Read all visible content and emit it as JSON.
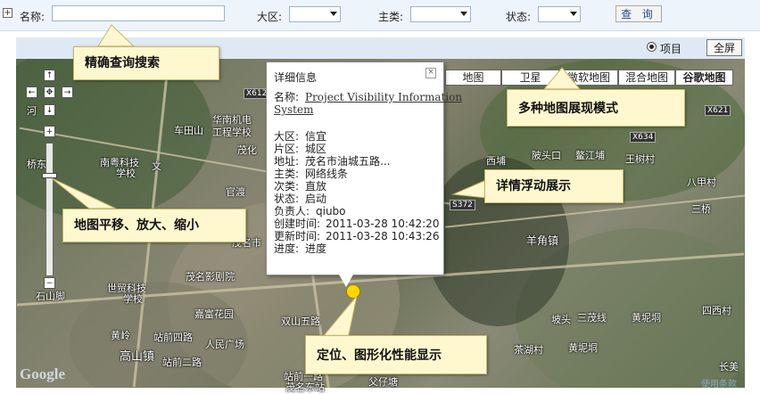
{
  "query": {
    "expand_icon": "+",
    "name_label": "名称:",
    "name_value": "",
    "region_label": "大区:",
    "region_value": "",
    "category_label": "主类:",
    "category_value": "",
    "status_label": "状态:",
    "status_value": "",
    "query_button": "查 询"
  },
  "map_header": {
    "radio_label": "项目",
    "fullscreen_button": "全屏"
  },
  "map_types": [
    "地图",
    "卫星",
    "微软地图",
    "混合地图",
    "谷歌地图"
  ],
  "nav": {
    "up": "↑",
    "left": "←",
    "center": "✥",
    "right": "→",
    "down": "↓",
    "zoom_in": "+",
    "zoom_out": "−"
  },
  "popup": {
    "title": "详细信息",
    "close": "×",
    "name_label": "名称:",
    "name_value_line1": "Project Visibility Information",
    "name_value_line2": "System",
    "rows": [
      {
        "label": "大区:",
        "value": "信宜"
      },
      {
        "label": "片区:",
        "value": "城区"
      },
      {
        "label": "地址:",
        "value": "茂名市油城五路..."
      },
      {
        "label": "主类:",
        "value": "网络线条"
      },
      {
        "label": "次类:",
        "value": "直放"
      },
      {
        "label": "状态:",
        "value": "启动"
      },
      {
        "label": "负责人:",
        "value": "qiubo"
      },
      {
        "label": "创建时间:",
        "value": "2011-03-28 10:42:20"
      },
      {
        "label": "更新时间:",
        "value": "2011-03-28 10:43:26"
      },
      {
        "label": "进度:",
        "value": "进度"
      }
    ]
  },
  "callouts": {
    "search": "精确查询搜索",
    "map_modes": "多种地图展现模式",
    "details": "详情浮动展示",
    "pan_zoom": "地图平移、放大、缩小",
    "locate": "定位、图形化性能显示"
  },
  "map_labels": [
    "河",
    "华南机电",
    "工程学校",
    "车田山",
    "X612",
    "茂化",
    "桥东",
    "南粤科技",
    "学校",
    "文",
    "官渡",
    "茂名市",
    "茂名影剧院",
    "世贸科技",
    "学校",
    "嘉富花园",
    "双山五路",
    "黄岭",
    "高山镇",
    "站前四路",
    "人民广场",
    "站前二路",
    "站前一路",
    "茂名东站",
    "石山脚",
    "父仔塘",
    "西埔",
    "陂头口",
    "鳌江埔",
    "王树村",
    "八甲村",
    "三桥",
    "羊角镇",
    "坡头",
    "三茂线",
    "黄坭垌",
    "四西村",
    "茶湖村",
    "黄坭垌",
    "长美",
    "X634",
    "S372",
    "X621"
  ],
  "footer": {
    "logo": "Google",
    "terms": "使用条款"
  },
  "colors": {
    "callout_bg": "#fff8cf",
    "marker": "#ffd700",
    "header_bg": "#eef4fb"
  }
}
